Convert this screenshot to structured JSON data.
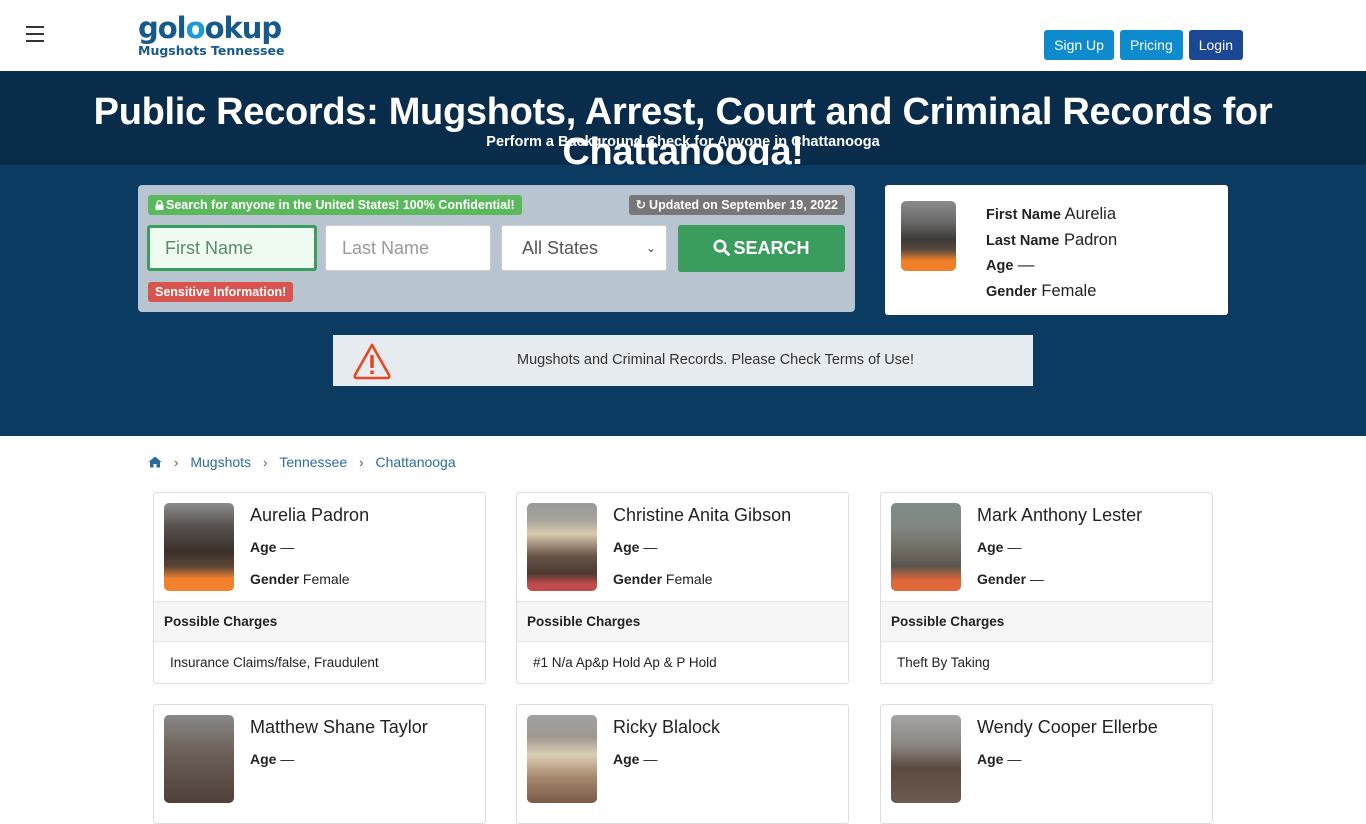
{
  "header": {
    "logo_main_prefix": "gol",
    "logo_main_accent": "o",
    "logo_main_suffix": "okup",
    "logo_sub": "Mugshots Tennessee",
    "buttons": {
      "signup": "Sign Up",
      "pricing": "Pricing",
      "login": "Login"
    },
    "colors": {
      "brand": "#155a8a",
      "button_blue": "#0e8bcd",
      "button_dark": "#1c4794"
    }
  },
  "hero": {
    "title": "Public Records: Mugshots, Arrest, Court and Criminal Records for Chattanooga!",
    "subtitle": "Perform a Background Check for Anyone in Chattanooga"
  },
  "search": {
    "confidential_badge": "Search for anyone in the United States! 100% Confidential!",
    "updated_badge": "Updated on September 19, 2022",
    "first_name_placeholder": "First Name",
    "last_name_placeholder": "Last Name",
    "state_selected": "All States",
    "search_button": "SEARCH",
    "sensitive_badge": "Sensitive Information!"
  },
  "featured_profile": {
    "first_name_label": "First Name",
    "first_name": "Aurelia",
    "last_name_label": "Last Name",
    "last_name": "Padron",
    "age_label": "Age",
    "age": "—",
    "gender_label": "Gender",
    "gender": "Female"
  },
  "notice": {
    "text": "Mugshots and Criminal Records. Please Check Terms of Use!"
  },
  "breadcrumb": {
    "items": [
      "Mugshots",
      "Tennessee",
      "Chattanooga"
    ]
  },
  "records": {
    "age_label": "Age",
    "gender_label": "Gender",
    "charges_label": "Possible Charges",
    "items": [
      {
        "name": "Aurelia Padron",
        "age": "—",
        "gender": "Female",
        "charges": "Insurance Claims/false, Fraudulent"
      },
      {
        "name": "Christine Anita Gibson",
        "age": "—",
        "gender": "Female",
        "charges": "#1 N/a Ap&p Hold Ap & P Hold"
      },
      {
        "name": "Mark Anthony Lester",
        "age": "—",
        "gender": "—",
        "charges": "Theft By Taking"
      },
      {
        "name": "Matthew Shane Taylor",
        "age": "—"
      },
      {
        "name": "Ricky Blalock",
        "age": "—"
      },
      {
        "name": "Wendy Cooper Ellerbe",
        "age": "—"
      }
    ]
  }
}
